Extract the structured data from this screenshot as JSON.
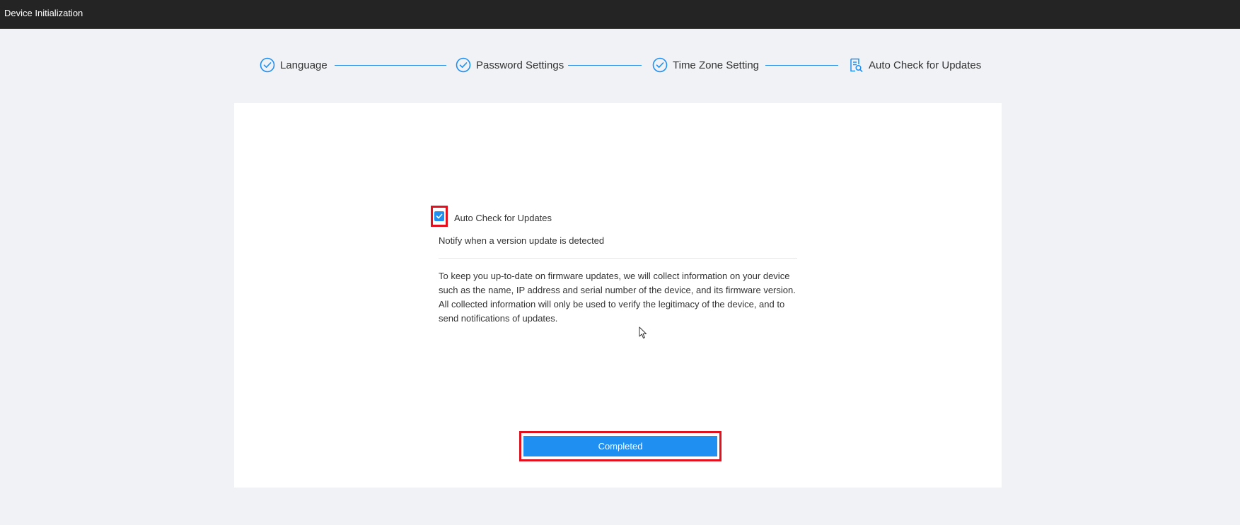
{
  "titlebar": {
    "title": "Device Initialization"
  },
  "steps": [
    {
      "label": "Language",
      "icon": "check-circle-icon",
      "state": "done"
    },
    {
      "label": "Password Settings",
      "icon": "check-circle-icon",
      "state": "done"
    },
    {
      "label": "Time Zone Setting",
      "icon": "check-circle-icon",
      "state": "done"
    },
    {
      "label": "Auto Check for Updates",
      "icon": "document-search-icon",
      "state": "current"
    }
  ],
  "auto_update": {
    "checkbox_label": "Auto Check for Updates",
    "checked": true,
    "subtitle": "Notify when a version update is detected",
    "description": "To keep you up-to-date on firmware updates, we will collect information on your device such as the name, IP address and serial number of the device, and its firmware version. All collected information will only be used to verify the legitimacy of the device, and to send notifications of updates."
  },
  "actions": {
    "completed_label": "Completed"
  },
  "colors": {
    "accent": "#1f8ff2",
    "titlebar_bg": "#242424",
    "page_bg": "#f0f2f5",
    "highlight": "#e3101d"
  }
}
